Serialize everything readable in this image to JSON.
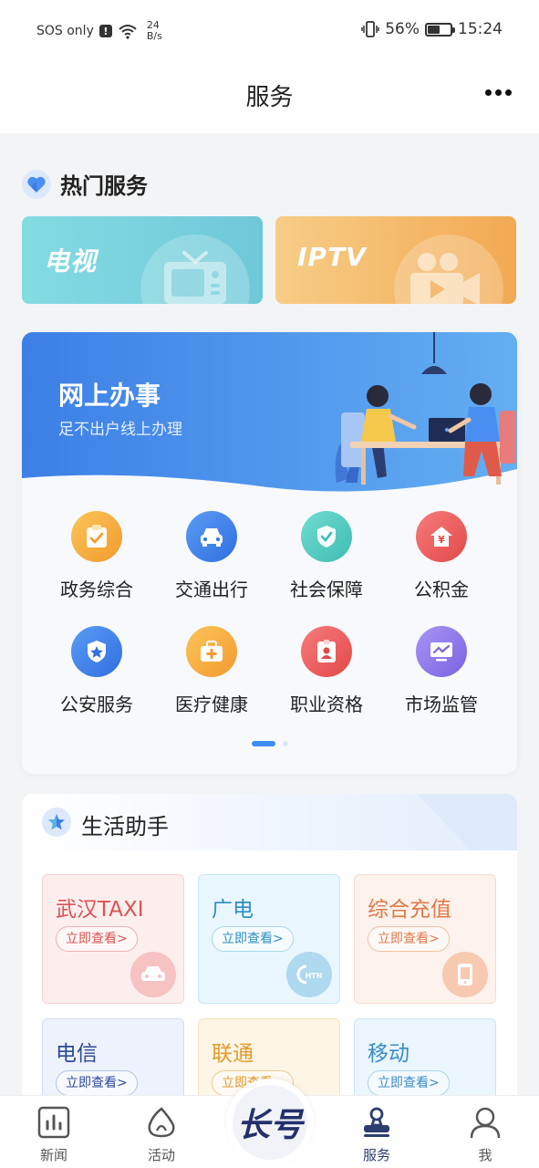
{
  "status_bar": {
    "carrier": "SOS only",
    "speed_value": "24",
    "speed_unit": "B/s",
    "battery": "56%",
    "battery_level": 0.56,
    "time": "15:24"
  },
  "nav": {
    "title": "服务"
  },
  "hot_services": {
    "title": "热门服务",
    "cards": [
      {
        "label": "电视",
        "icon": "tv-icon"
      },
      {
        "label": "IPTV",
        "icon": "video-camera-icon"
      }
    ]
  },
  "online_affairs": {
    "title": "网上办事",
    "subtitle": "足不出户线上办理",
    "items": [
      {
        "label": "政务综合",
        "icon": "clipboard-check-icon",
        "color": "#f5a623"
      },
      {
        "label": "交通出行",
        "icon": "car-icon",
        "color": "#3f7ee8"
      },
      {
        "label": "社会保障",
        "icon": "shield-check-icon",
        "color": "#3fc5b8"
      },
      {
        "label": "公积金",
        "icon": "house-yuan-icon",
        "color": "#ee5a5a"
      },
      {
        "label": "公安服务",
        "icon": "police-badge-icon",
        "color": "#3f7ee8"
      },
      {
        "label": "医疗健康",
        "icon": "medical-kit-icon",
        "color": "#f5a623"
      },
      {
        "label": "职业资格",
        "icon": "id-card-icon",
        "color": "#ee5a5a"
      },
      {
        "label": "市场监管",
        "icon": "monitor-chart-icon",
        "color": "#8a72e8"
      }
    ],
    "page_count": 2,
    "current_page": 1
  },
  "life_assistant": {
    "title": "生活助手",
    "tiles": [
      {
        "title": "武汉TAXI",
        "button": "立即查看>",
        "icon": "taxi-icon"
      },
      {
        "title": "广电",
        "button": "立即查看>",
        "icon": "htn-logo-icon"
      },
      {
        "title": "综合充值",
        "button": "立即查看>",
        "icon": "phone-icon"
      },
      {
        "title": "电信",
        "button": "立即查看>",
        "icon": ""
      },
      {
        "title": "联通",
        "button": "立即查看>",
        "icon": ""
      },
      {
        "title": "移动",
        "button": "立即查看>",
        "icon": ""
      }
    ]
  },
  "tab_bar": {
    "tabs": [
      {
        "label": "新闻",
        "icon": "news-chart-icon"
      },
      {
        "label": "活动",
        "icon": "activity-icon"
      },
      {
        "label": "服务",
        "icon": "service-stamp-icon",
        "active": true
      },
      {
        "label": "我",
        "icon": "user-icon"
      }
    ],
    "center_logo": "长号"
  }
}
